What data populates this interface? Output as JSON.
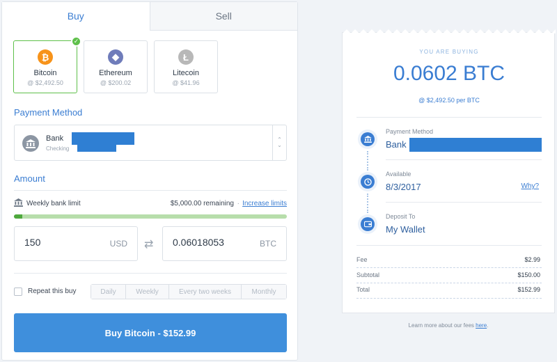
{
  "tabs": [
    {
      "label": "Buy",
      "active": true
    },
    {
      "label": "Sell",
      "active": false
    }
  ],
  "currencies": [
    {
      "name": "Bitcoin",
      "price": "@ $2,492.50",
      "symbol": "₿",
      "color": "#f7931a",
      "selected": true
    },
    {
      "name": "Ethereum",
      "price": "@ $200.02",
      "symbol": "◆",
      "color": "#6f7cba",
      "selected": false
    },
    {
      "name": "Litecoin",
      "price": "@ $41.96",
      "symbol": "Ł",
      "color": "#b8b8b8",
      "selected": false
    }
  ],
  "payment": {
    "title": "Payment Method",
    "bank_name": "Bank",
    "account_type": "Checking"
  },
  "amount": {
    "title": "Amount",
    "limit_label": "Weekly bank limit",
    "remaining": "$5,000.00 remaining",
    "separator": "·",
    "increase_link": "Increase limits",
    "limit_used_fraction": 0.03,
    "usd_value": "150",
    "usd_unit": "USD",
    "btc_value": "0.06018053",
    "btc_unit": "BTC"
  },
  "repeat": {
    "label": "Repeat this buy",
    "options": [
      "Daily",
      "Weekly",
      "Every two weeks",
      "Monthly"
    ]
  },
  "buy_button": "Buy Bitcoin - $152.99",
  "receipt": {
    "heading": "YOU ARE BUYING",
    "amount": "0.0602 BTC",
    "rate": "@ $2,492.50 per BTC",
    "payment_label": "Payment Method",
    "payment_value": "Bank",
    "available_label": "Available",
    "available_value": "8/3/2017",
    "why_link": "Why?",
    "deposit_label": "Deposit To",
    "deposit_value": "My Wallet",
    "fees": [
      {
        "label": "Fee",
        "value": "$2.99"
      },
      {
        "label": "Subtotal",
        "value": "$150.00"
      },
      {
        "label": "Total",
        "value": "$152.99"
      }
    ]
  },
  "footer": {
    "text": "Learn more about our fees ",
    "link": "here",
    "suffix": "."
  },
  "colors": {
    "accent": "#3a7dd2",
    "button": "#3f8fdc",
    "success": "#5ec04a",
    "redaction": "#2f7fd3"
  }
}
